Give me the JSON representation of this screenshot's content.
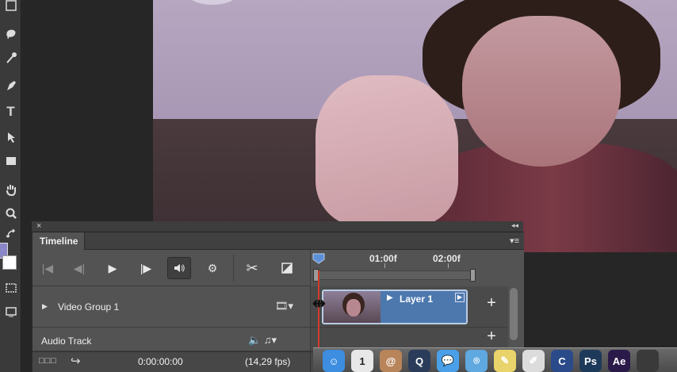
{
  "app": {
    "accent_color": "#4c78ae",
    "playhead_color": "#d23a2a"
  },
  "toolbar": {
    "tools": [
      "marquee-tool",
      "lasso-tool",
      "magic-wand-tool",
      "pen-tool",
      "type-tool",
      "path-selection-tool",
      "rectangle-tool",
      "hand-tool",
      "zoom-tool",
      "swap-colors"
    ],
    "type_tool_glyph": "T",
    "foreground_color": "#8a86c8",
    "background_color": "#ffffff"
  },
  "timeline": {
    "panel_title": "Timeline",
    "close_glyph": "×",
    "collapse_glyph": "◂◂",
    "menu_glyph": "▾≡",
    "controls": {
      "go_first": "|◀",
      "step_back": "◀|",
      "play": "▶",
      "step_forward": "|▶",
      "audio": "🔈",
      "settings": "⚙",
      "split": "✂",
      "transition": "◪"
    },
    "ruler": {
      "labels": [
        "01:00f",
        "02:00f"
      ]
    },
    "tracks": [
      {
        "name": "Video Group 1",
        "type": "video",
        "right_glyph": "🎞▾"
      },
      {
        "name": "Audio Track",
        "type": "audio",
        "right_glyph": "🔈 ♫▾"
      }
    ],
    "clip": {
      "label": "Layer 1",
      "play_glyph": "▶",
      "corner_glyph": "▶"
    },
    "add_glyph": "+",
    "footer": {
      "icons": "□□□",
      "arrow": "↪",
      "timecode": "0:00:00:00",
      "fps": "(14,29 fps)"
    }
  },
  "dock": {
    "apps": [
      {
        "name": "finder",
        "glyph": "☺",
        "color": "#3d8de0"
      },
      {
        "name": "calendar",
        "glyph": "1",
        "color": "#e8e8e8"
      },
      {
        "name": "address-book",
        "glyph": "@",
        "color": "#b8845a"
      },
      {
        "name": "quicktime",
        "glyph": "Q",
        "color": "#2a3c5a"
      },
      {
        "name": "messages",
        "glyph": "💬",
        "color": "#4aa0e8"
      },
      {
        "name": "safari",
        "glyph": "⌾",
        "color": "#5fa8e0"
      },
      {
        "name": "notes",
        "glyph": "✎",
        "color": "#e8d46a"
      },
      {
        "name": "textedit",
        "glyph": "✐",
        "color": "#dcdcdc"
      },
      {
        "name": "cinema-4d",
        "glyph": "C",
        "color": "#2a4a8a"
      },
      {
        "name": "photoshop",
        "glyph": "Ps",
        "color": "#1e3a5a"
      },
      {
        "name": "after-effects",
        "glyph": "Ae",
        "color": "#2a1a4a"
      },
      {
        "name": "app-extra",
        "glyph": "",
        "color": "#3a3a3a"
      }
    ]
  }
}
